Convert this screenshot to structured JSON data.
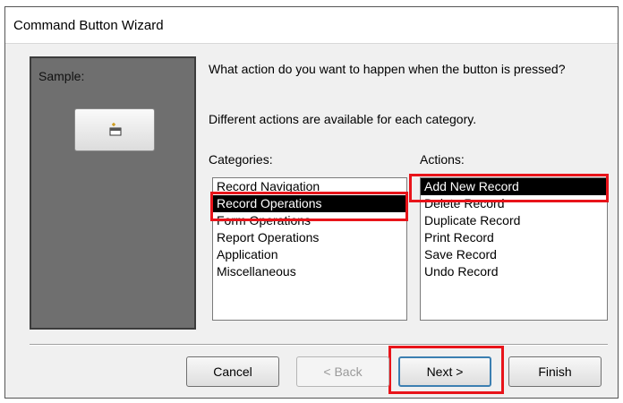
{
  "window": {
    "title": "Command Button Wizard"
  },
  "sample": {
    "label": "Sample:"
  },
  "prompt": {
    "question": "What action do you want to happen when the button is pressed?",
    "hint": "Different actions are available for each category."
  },
  "categories": {
    "label": "Categories:",
    "items": [
      "Record Navigation",
      "Record Operations",
      "Form Operations",
      "Report Operations",
      "Application",
      "Miscellaneous"
    ],
    "selected": "Record Operations"
  },
  "actions": {
    "label": "Actions:",
    "items": [
      "Add New Record",
      "Delete Record",
      "Duplicate Record",
      "Print Record",
      "Save Record",
      "Undo Record"
    ],
    "selected": "Add New Record"
  },
  "buttons": {
    "cancel": "Cancel",
    "back": "< Back",
    "next": "Next >",
    "finish": "Finish"
  },
  "colors": {
    "highlight": "#e8141a",
    "selection": "#000000",
    "sample_panel": "#6f6f6f"
  },
  "icons": [
    "add-record-icon"
  ]
}
